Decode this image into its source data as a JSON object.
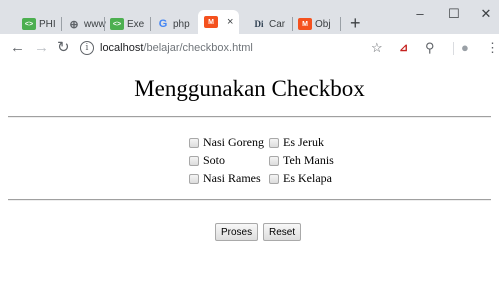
{
  "browser": {
    "tabs": [
      {
        "label": "PHI",
        "favicon": "code-academy-icon",
        "favicon_color": "#4caf50"
      },
      {
        "label": "www",
        "favicon": "globe-icon",
        "favicon_color": "#5f6368"
      },
      {
        "label": "Exe",
        "favicon": "code-academy-icon",
        "favicon_color": "#4caf50"
      },
      {
        "label": "php",
        "favicon": "google-icon",
        "favicon_color": "#4285f4"
      },
      {
        "label": "",
        "favicon": "malasngoding-icon",
        "favicon_color": "#f4511e",
        "active": true
      },
      {
        "label": "Car",
        "favicon": "dicoding-icon",
        "favicon_color": "#2d3e50"
      },
      {
        "label": "Obj",
        "favicon": "malasngoding-icon",
        "favicon_color": "#f4511e"
      }
    ],
    "close_glyph": "×",
    "new_tab_glyph": "+",
    "window_controls": {
      "minimize": "–",
      "maximize": "☐",
      "close": "✕"
    },
    "url_host": "localhost",
    "url_path": "/belajar/checkbox.html"
  },
  "page": {
    "title": "Menggunakan Checkbox",
    "checkboxes_left": [
      {
        "label": "Nasi Goreng",
        "checked": false
      },
      {
        "label": "Soto",
        "checked": false
      },
      {
        "label": "Nasi Rames",
        "checked": false
      }
    ],
    "checkboxes_right": [
      {
        "label": "Es Jeruk",
        "checked": false
      },
      {
        "label": "Teh Manis",
        "checked": false
      },
      {
        "label": "Es Kelapa",
        "checked": false
      }
    ],
    "buttons": {
      "submit_label": "Proses",
      "reset_label": "Reset"
    }
  }
}
